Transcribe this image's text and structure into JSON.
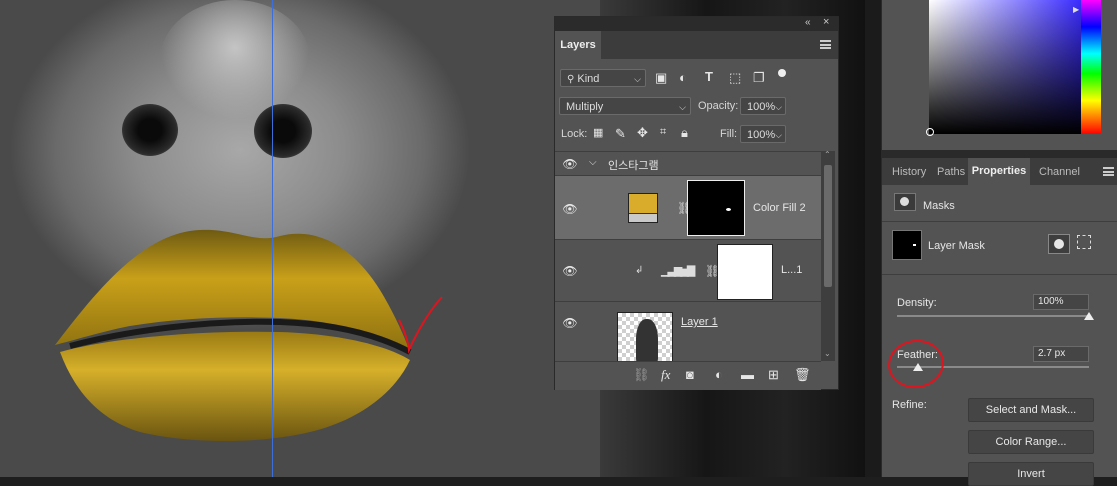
{
  "layers_panel": {
    "title": "Layers",
    "filter_kind": "Kind",
    "blend_mode": "Multiply",
    "opacity_label": "Opacity:",
    "opacity_value": "100%",
    "lock_label": "Lock:",
    "fill_label": "Fill:",
    "fill_value": "100%",
    "group_name": "인스타그램",
    "layers": [
      {
        "name": "Color Fill 2",
        "fill_color": "#d9ac2c"
      },
      {
        "name": "L...1"
      },
      {
        "name": "Layer 1"
      }
    ],
    "fx_label": "fx"
  },
  "right_panel": {
    "tabs": [
      "History",
      "Paths",
      "Properties",
      "Channel"
    ],
    "active_tab": "Properties",
    "masks_label": "Masks",
    "layer_mask_label": "Layer Mask",
    "density_label": "Density:",
    "density_value": "100%",
    "density_level": 1.0,
    "feather_label": "Feather:",
    "feather_value": "2.7 px",
    "feather_level": 0.11,
    "refine_label": "Refine:",
    "buttons": {
      "select_and_mask": "Select and Mask...",
      "color_range": "Color Range...",
      "invert": "Invert"
    }
  },
  "colors": {
    "lip_gold": "#c9a019",
    "annotation_red": "#e0141e",
    "guide_blue": "#3d6fd8"
  }
}
